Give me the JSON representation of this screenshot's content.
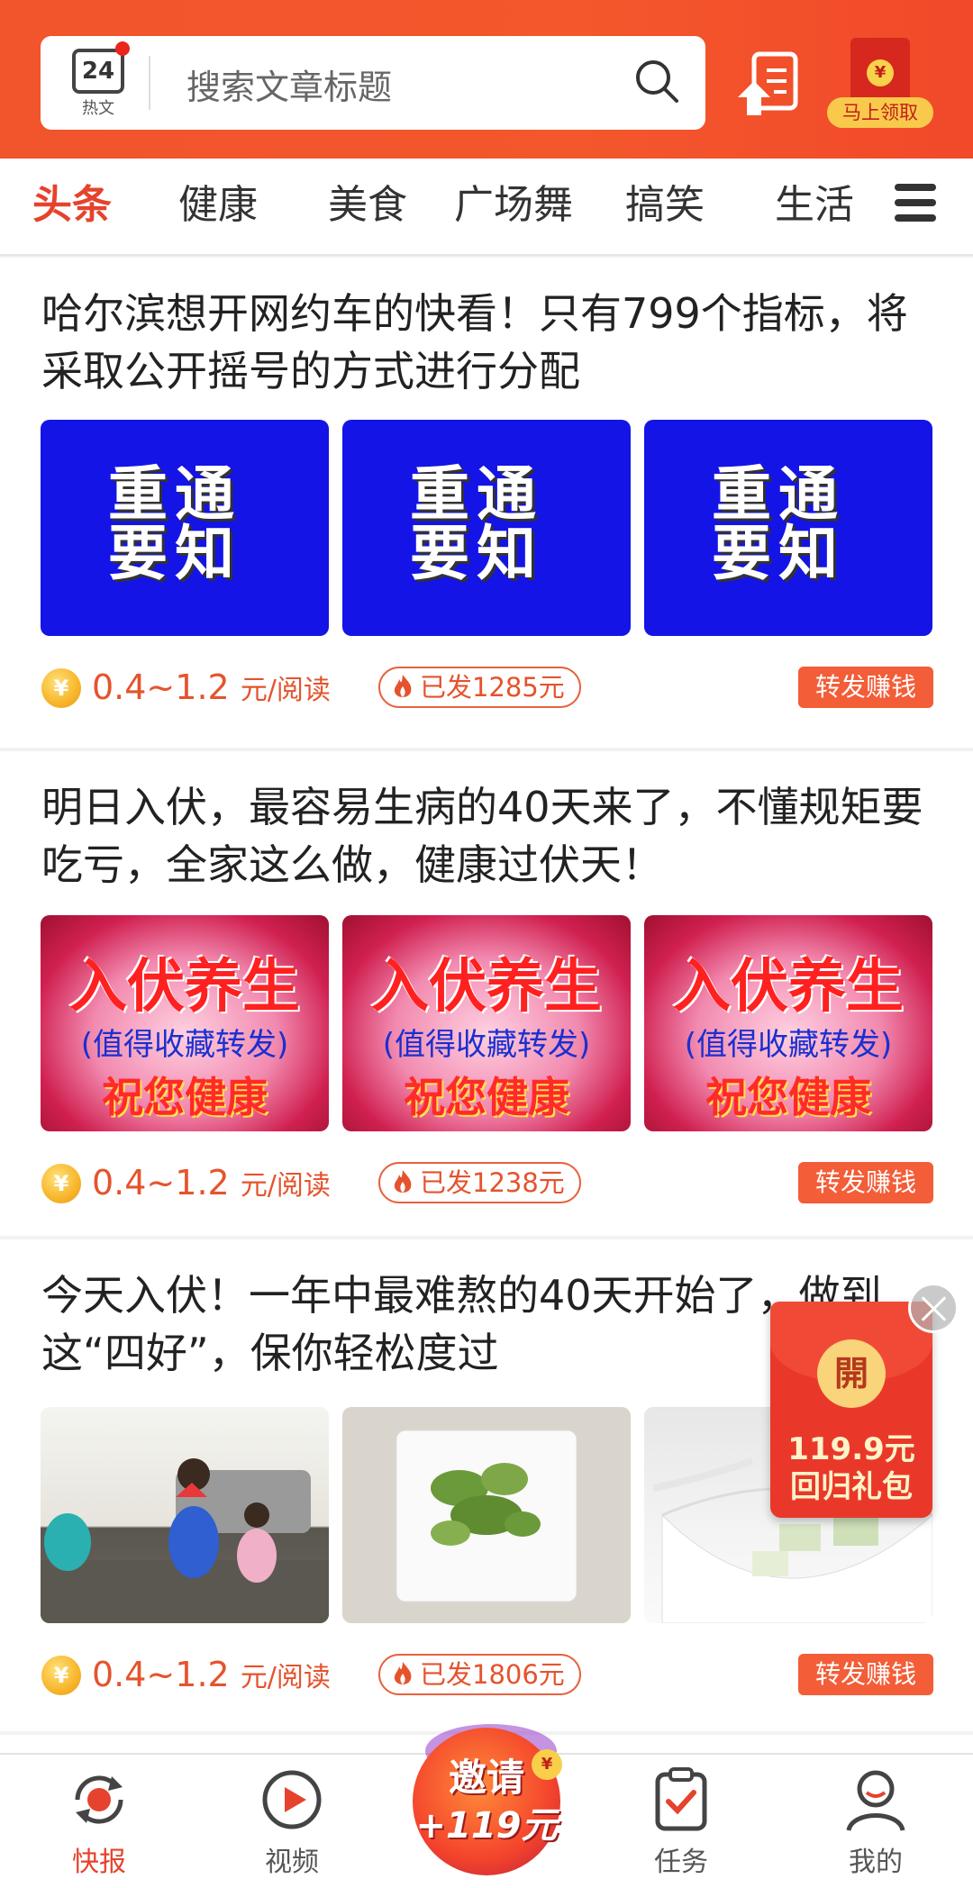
{
  "header": {
    "hot_badge_number": "24",
    "hot_badge_label": "热文",
    "search_placeholder": "搜索文章标题",
    "redpack_label": "马上领取",
    "redpack_symbol": "¥"
  },
  "tabs": [
    {
      "label": "头条",
      "active": true
    },
    {
      "label": "健康",
      "active": false
    },
    {
      "label": "美食",
      "active": false
    },
    {
      "label": "广场舞",
      "active": false
    },
    {
      "label": "搞笑",
      "active": false
    },
    {
      "label": "生活",
      "active": false
    }
  ],
  "articles": [
    {
      "title": "哈尔滨想开网约车的快看！只有799个指标，将采取公开摇号的方式进行分配",
      "thumb_text": [
        "重通",
        "要知"
      ],
      "price": "0.4~1.2",
      "price_unit": "元/阅读",
      "sent": "已发1285元",
      "share_label": "转发赚钱"
    },
    {
      "title": "明日入伏，最容易生病的40天来了，不懂规矩要吃亏，全家这么做，健康过伏天！",
      "thumb_text": [
        "入伏养生",
        "(值得收藏转发)",
        "祝您健康"
      ],
      "price": "0.4~1.2",
      "price_unit": "元/阅读",
      "sent": "已发1238元",
      "share_label": "转发赚钱"
    },
    {
      "title": "今天入伏！一年中最难熬的40天开始了，做到这“四好”，保你轻松度过",
      "price": "0.4~1.2",
      "price_unit": "元/阅读",
      "sent": "已发1806元",
      "share_label": "转发赚钱"
    }
  ],
  "coin_symbol": "¥",
  "floating_redpack": {
    "coin_text": "開",
    "amount": "119.9元",
    "label": "回归礼包"
  },
  "bottom_nav": {
    "items": [
      {
        "label": "快报",
        "active": true
      },
      {
        "label": "视频",
        "active": false
      },
      {
        "label": "任务",
        "active": false
      },
      {
        "label": "我的",
        "active": false
      }
    ],
    "invite_line1": "邀请",
    "invite_line2": "+119元",
    "invite_coin": "¥"
  },
  "colors": {
    "brand": "#f2542c",
    "active_tab": "#e5432d",
    "share_button": "#f35d37",
    "thumb_blue": "#1414e6"
  }
}
